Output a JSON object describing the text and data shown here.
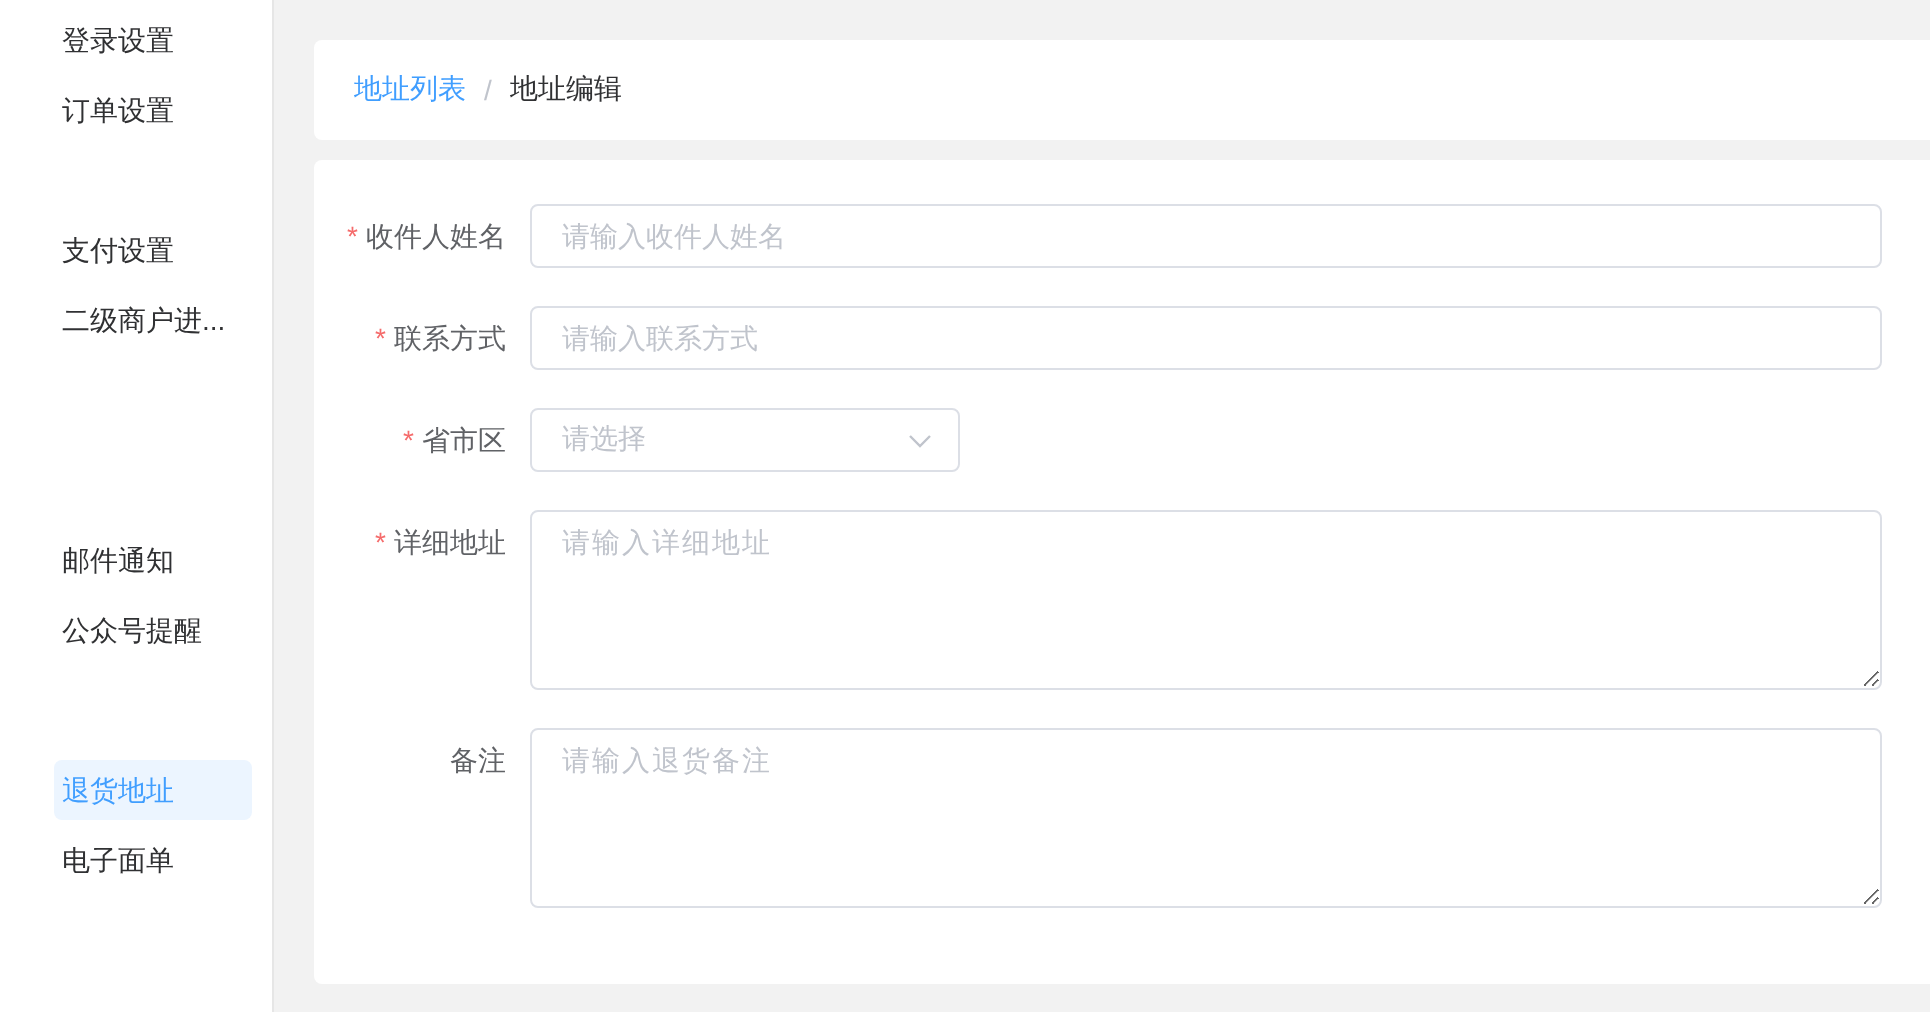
{
  "sidebar": {
    "groups": [
      {
        "items": [
          {
            "label": "登录设置",
            "selected": false
          },
          {
            "label": "订单设置",
            "selected": false
          }
        ]
      },
      {
        "items": [
          {
            "label": "支付设置",
            "selected": false
          },
          {
            "label": "二级商户进...",
            "selected": false
          }
        ]
      },
      {
        "items": [
          {
            "label": "邮件通知",
            "selected": false
          },
          {
            "label": "公众号提醒",
            "selected": false
          }
        ]
      },
      {
        "items": [
          {
            "label": "退货地址",
            "selected": true
          },
          {
            "label": "电子面单",
            "selected": false
          }
        ]
      }
    ]
  },
  "breadcrumb": {
    "separator": "/",
    "items": [
      {
        "label": "地址列表",
        "kind": "link"
      },
      {
        "label": "地址编辑",
        "kind": "current"
      }
    ]
  },
  "form": {
    "required_mark": "*",
    "fields": [
      {
        "label": "收件人姓名",
        "required": true,
        "kind": "input",
        "placeholder": "请输入收件人姓名"
      },
      {
        "label": "联系方式",
        "required": true,
        "kind": "input",
        "placeholder": "请输入联系方式"
      },
      {
        "label": "省市区",
        "required": true,
        "kind": "select",
        "placeholder": "请选择"
      },
      {
        "label": "详细地址",
        "required": true,
        "kind": "textarea",
        "placeholder": "请输入详细地址"
      },
      {
        "label": "备注",
        "required": false,
        "kind": "textarea",
        "placeholder": "请输入退货备注"
      }
    ]
  }
}
